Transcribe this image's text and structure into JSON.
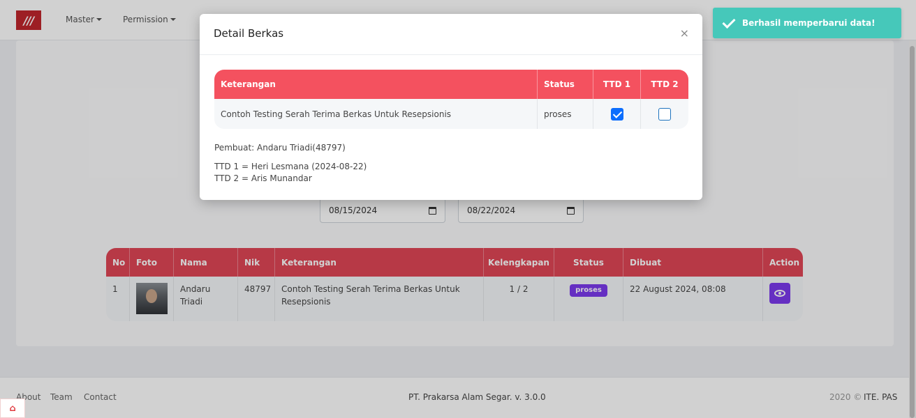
{
  "navbar": {
    "logo": "///",
    "menu": [
      {
        "label": "Master"
      },
      {
        "label": "Permission"
      }
    ]
  },
  "filters": {
    "date_from": "08/15/2024",
    "date_to": "08/22/2024"
  },
  "main_table": {
    "headers": [
      "No",
      "Foto",
      "Nama",
      "Nik",
      "Keterangan",
      "Kelengkapan",
      "Status",
      "Dibuat",
      "Action"
    ],
    "rows": [
      {
        "no": "1",
        "nama": "Andaru Triadi",
        "nik": "48797",
        "keterangan": "Contoh Testing Serah Terima Berkas Untuk Resepsionis",
        "kelengkapan": "1 / 2",
        "status": "proses",
        "dibuat": "22 August 2024, 08:08"
      }
    ]
  },
  "footer": {
    "links": [
      "About",
      "Team",
      "Contact"
    ],
    "center": "PT. Prakarsa Alam Segar. v. 3.0.0",
    "year": "2020 ©",
    "brand": "ITE. PAS"
  },
  "modal": {
    "title": "Detail Berkas",
    "close": "×",
    "table": {
      "headers": [
        "Keterangan",
        "Status",
        "TTD 1",
        "TTD 2"
      ],
      "row": {
        "keterangan": "Contoh Testing Serah Terima Berkas Untuk Resepsionis",
        "status": "proses",
        "ttd1_checked": true,
        "ttd2_checked": false
      }
    },
    "pembuat": "Pembuat: Andaru Triadi(48797)",
    "ttd1": "TTD 1 = Heri Lesmana (2024-08-22)",
    "ttd2": "TTD 2 = Aris Munandar"
  },
  "toast": {
    "message": "Berhasil memperbarui data!"
  },
  "colors": {
    "table_header": "#e04656",
    "modal_table_header": "#f4515f",
    "badge": "#7c3aed",
    "toast": "#46c8ba",
    "checkbox": "#0d6efd"
  }
}
